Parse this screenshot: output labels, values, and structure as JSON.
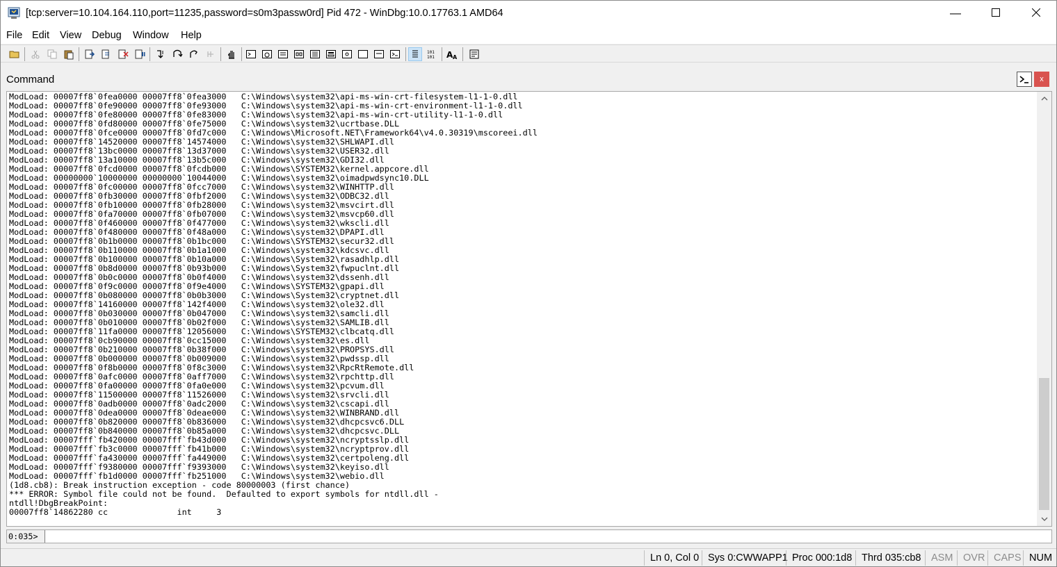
{
  "window": {
    "title": "[tcp:server=10.104.164.110,port=11235,password=s0m3passw0rd] Pid 472 - WinDbg:10.0.17763.1 AMD64",
    "min_glyph": "—",
    "max_glyph": "☐",
    "close_glyph": "✕"
  },
  "menu": {
    "items": [
      "File",
      "Edit",
      "View",
      "Debug",
      "Window",
      "Help"
    ]
  },
  "command_pane": {
    "caption": "Command",
    "close_glyph": "x",
    "prompt": "0:035>",
    "input_value": "",
    "output": [
      "ModLoad: 00007ff8`0fea0000 00007ff8`0fea3000   C:\\Windows\\system32\\api-ms-win-crt-filesystem-l1-1-0.dll",
      "ModLoad: 00007ff8`0fe90000 00007ff8`0fe93000   C:\\Windows\\system32\\api-ms-win-crt-environment-l1-1-0.dll",
      "ModLoad: 00007ff8`0fe80000 00007ff8`0fe83000   C:\\Windows\\system32\\api-ms-win-crt-utility-l1-1-0.dll",
      "ModLoad: 00007ff8`0fd80000 00007ff8`0fe75000   C:\\Windows\\system32\\ucrtbase.DLL",
      "ModLoad: 00007ff8`0fce0000 00007ff8`0fd7c000   C:\\Windows\\Microsoft.NET\\Framework64\\v4.0.30319\\mscoreei.dll",
      "ModLoad: 00007ff8`14520000 00007ff8`14574000   C:\\Windows\\system32\\SHLWAPI.dll",
      "ModLoad: 00007ff8`13bc0000 00007ff8`13d37000   C:\\Windows\\system32\\USER32.dll",
      "ModLoad: 00007ff8`13a10000 00007ff8`13b5c000   C:\\Windows\\system32\\GDI32.dll",
      "ModLoad: 00007ff8`0fcd0000 00007ff8`0fcdb000   C:\\Windows\\SYSTEM32\\kernel.appcore.dll",
      "ModLoad: 00000000`10000000 00000000`10044000   C:\\Windows\\system32\\oimadpwdsync10.DLL",
      "ModLoad: 00007ff8`0fc00000 00007ff8`0fcc7000   C:\\Windows\\system32\\WINHTTP.dll",
      "ModLoad: 00007ff8`0fb30000 00007ff8`0fbf2000   C:\\Windows\\system32\\ODBC32.dll",
      "ModLoad: 00007ff8`0fb10000 00007ff8`0fb28000   C:\\Windows\\system32\\msvcirt.dll",
      "ModLoad: 00007ff8`0fa70000 00007ff8`0fb07000   C:\\Windows\\system32\\msvcp60.dll",
      "ModLoad: 00007ff8`0f460000 00007ff8`0f477000   C:\\Windows\\system32\\wkscli.dll",
      "ModLoad: 00007ff8`0f480000 00007ff8`0f48a000   C:\\Windows\\system32\\DPAPI.dll",
      "ModLoad: 00007ff8`0b1b0000 00007ff8`0b1bc000   C:\\Windows\\SYSTEM32\\secur32.dll",
      "ModLoad: 00007ff8`0b110000 00007ff8`0b1a1000   C:\\Windows\\system32\\kdcsvc.dll",
      "ModLoad: 00007ff8`0b100000 00007ff8`0b10a000   C:\\Windows\\System32\\rasadhlp.dll",
      "ModLoad: 00007ff8`0b8d0000 00007ff8`0b93b000   C:\\Windows\\System32\\fwpuclnt.dll",
      "ModLoad: 00007ff8`0b0c0000 00007ff8`0b0f4000   C:\\Windows\\system32\\dssenh.dll",
      "ModLoad: 00007ff8`0f9c0000 00007ff8`0f9e4000   C:\\Windows\\SYSTEM32\\gpapi.dll",
      "ModLoad: 00007ff8`0b080000 00007ff8`0b0b3000   C:\\Windows\\System32\\cryptnet.dll",
      "ModLoad: 00007ff8`14160000 00007ff8`142f4000   C:\\Windows\\system32\\ole32.dll",
      "ModLoad: 00007ff8`0b030000 00007ff8`0b047000   C:\\Windows\\system32\\samcli.dll",
      "ModLoad: 00007ff8`0b010000 00007ff8`0b02f000   C:\\Windows\\system32\\SAMLIB.dll",
      "ModLoad: 00007ff8`11fa0000 00007ff8`12056000   C:\\Windows\\SYSTEM32\\clbcatq.dll",
      "ModLoad: 00007ff8`0cb90000 00007ff8`0cc15000   C:\\Windows\\system32\\es.dll",
      "ModLoad: 00007ff8`0b210000 00007ff8`0b38f000   C:\\Windows\\system32\\PROPSYS.dll",
      "ModLoad: 00007ff8`0b000000 00007ff8`0b009000   C:\\Windows\\system32\\pwdssp.dll",
      "ModLoad: 00007ff8`0f8b0000 00007ff8`0f8c3000   C:\\Windows\\system32\\RpcRtRemote.dll",
      "ModLoad: 00007ff8`0afc0000 00007ff8`0aff7000   C:\\Windows\\system32\\rpchttp.dll",
      "ModLoad: 00007ff8`0fa00000 00007ff8`0fa0e000   C:\\Windows\\system32\\pcvum.dll",
      "ModLoad: 00007ff8`11500000 00007ff8`11526000   C:\\Windows\\system32\\srvcli.dll",
      "ModLoad: 00007ff8`0adb0000 00007ff8`0adc2000   C:\\Windows\\system32\\cscapi.dll",
      "ModLoad: 00007ff8`0dea0000 00007ff8`0deae000   C:\\Windows\\system32\\WINBRAND.dll",
      "ModLoad: 00007ff8`0b820000 00007ff8`0b836000   C:\\Windows\\system32\\dhcpcsvc6.DLL",
      "ModLoad: 00007ff8`0b840000 00007ff8`0b85a000   C:\\Windows\\system32\\dhcpcsvc.DLL",
      "ModLoad: 00007fff`fb420000 00007fff`fb43d000   C:\\Windows\\system32\\ncryptsslp.dll",
      "ModLoad: 00007fff`fb3c0000 00007fff`fb41b000   C:\\Windows\\system32\\ncryptprov.dll",
      "ModLoad: 00007fff`fa430000 00007fff`fa449000   C:\\Windows\\system32\\certpoleng.dll",
      "ModLoad: 00007fff`f9380000 00007fff`f9393000   C:\\Windows\\system32\\keyiso.dll",
      "ModLoad: 00007fff`fb1d0000 00007fff`fb251000   C:\\Windows\\system32\\webio.dll",
      "(1d8.cb8): Break instruction exception - code 80000003 (first chance)",
      "*** ERROR: Symbol file could not be found.  Defaulted to export symbols for ntdll.dll - ",
      "ntdll!DbgBreakPoint:",
      "00007ff8`14862280 cc              int     3"
    ]
  },
  "status": {
    "position": "Ln 0, Col 0",
    "sys": "Sys 0:CWWAPP1",
    "proc": "Proc 000:1d8",
    "thrd": "Thrd 035:cb8",
    "asm": "ASM",
    "ovr": "OVR",
    "caps": "CAPS",
    "num": "NUM"
  },
  "colors": {
    "background": "#f0f0f0",
    "output_bg": "#ffffff",
    "pane_close": "#d9534f",
    "active_tool": "#cce4f7"
  }
}
